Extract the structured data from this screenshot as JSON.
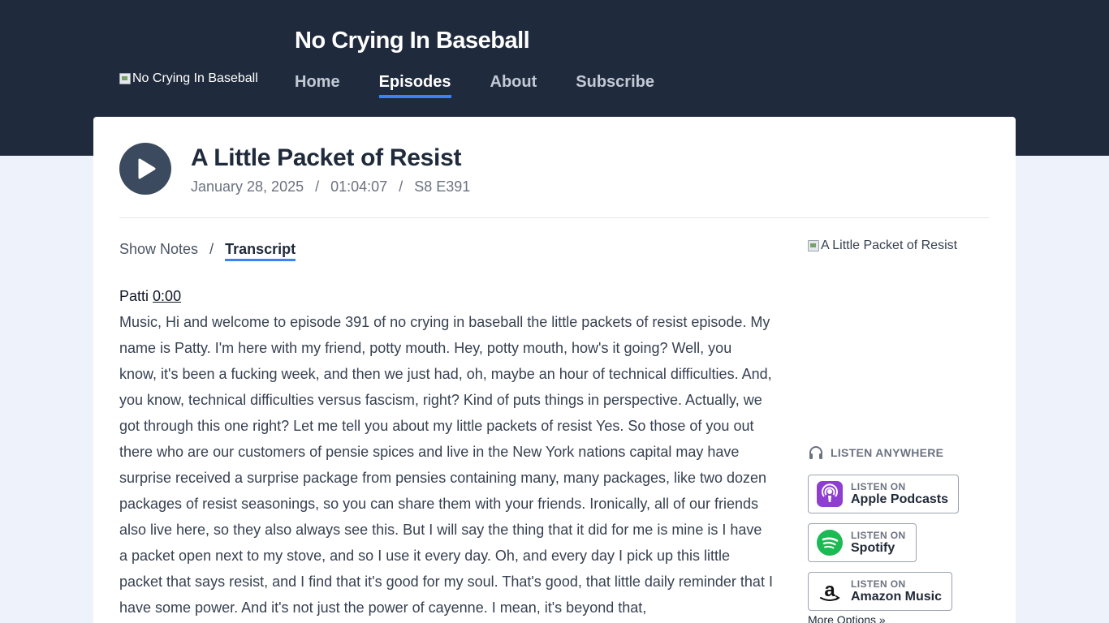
{
  "site": {
    "title": "No Crying In Baseball",
    "logo_alt": "No Crying In Baseball"
  },
  "nav": [
    {
      "label": "Home"
    },
    {
      "label": "Episodes"
    },
    {
      "label": "About"
    },
    {
      "label": "Subscribe"
    }
  ],
  "episode": {
    "title": "A Little Packet of Resist",
    "date": "January 28, 2025",
    "duration": "01:04:07",
    "number": "S8 E391",
    "separator": "/",
    "cover_alt": "A Little Packet of Resist"
  },
  "tabs": {
    "show_notes": "Show Notes",
    "separator": "/",
    "transcript": "Transcript"
  },
  "transcript": {
    "speaker": "Patti",
    "timestamp": "0:00",
    "text": "Music, Hi and welcome to episode 391 of no crying in baseball the little packets of resist episode. My name is Patty. I'm here with my friend, potty mouth. Hey, potty mouth, how's it going? Well, you know, it's been a fucking week, and then we just had, oh, maybe an hour of technical difficulties. And, you know, technical difficulties versus fascism, right? Kind of puts things in perspective. Actually, we got through this one right? Let me tell you about my little packets of resist Yes. So those of you out there who are our customers of pensie spices and live in the New York nations capital may have surprise received a surprise package from pensies containing many, many packages, like two dozen packages of resist seasonings, so you can share them with your friends. Ironically, all of our friends also live here, so they also always see this. But I will say the thing that it did for me is mine is I have a packet open next to my stove, and so I use it every day. Oh, and every day I pick up this little packet that says resist, and I find that it's good for my soul. That's good, that little daily reminder that I have some power. And it's not just the power of cayenne. I mean, it's beyond that,"
  },
  "listen": {
    "heading": "LISTEN ANYWHERE",
    "platforms": [
      {
        "small": "LISTEN ON",
        "name": "Apple Podcasts",
        "icon": "apple-podcasts-icon",
        "color": "#8e3fd0"
      },
      {
        "small": "LISTEN ON",
        "name": "Spotify",
        "icon": "spotify-icon",
        "color": "#1db954"
      },
      {
        "small": "LISTEN ON",
        "name": "Amazon Music",
        "icon": "amazon-icon",
        "color": "#111111"
      }
    ],
    "more": "More Options »"
  }
}
